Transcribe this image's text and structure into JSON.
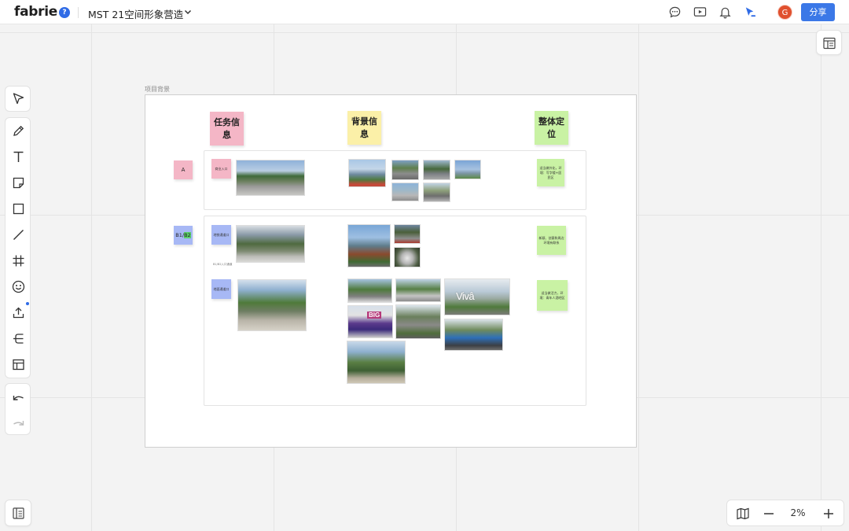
{
  "app": {
    "logo": "fabrie",
    "help": "?",
    "title": "MST 21空间形象营造",
    "avatar_letter": "G",
    "share_label": "分享"
  },
  "colors": {
    "accent": "#3b78e7",
    "pink": "#f4b6c6",
    "yellow": "#fbf0a8",
    "green": "#c9f2a4",
    "blue": "#a7b8f5"
  },
  "icons": {
    "top": [
      "comment-icon",
      "present-icon",
      "bell-icon",
      "cursor-share-icon"
    ],
    "tools": [
      "select-icon",
      "pen-icon",
      "text-icon",
      "sticky-note-icon",
      "rectangle-icon",
      "line-icon",
      "frame-icon",
      "emoji-icon",
      "upload-icon",
      "mindmap-icon",
      "table-icon",
      "undo-icon",
      "redo-icon"
    ]
  },
  "board": {
    "frame_label": "项目背景",
    "headers": {
      "task": "任务信息",
      "background": "背景信息",
      "positioning": "整体定位"
    },
    "rows": {
      "a_label": "A",
      "b_label_prefix": "B1/",
      "b_label_highlight": "B2"
    },
    "notes": {
      "a_task": "商业入口",
      "a_position": "适当做外化，环境：写字楼+居民区",
      "b1_task": "地铁通道口",
      "b1_caption": "B1/B2入口通道",
      "b1_position": "新颖、创意和周边环境有联系",
      "b2_task": "地面通道口",
      "b2_position": "适当做活力，环境：青年人酒吧区"
    },
    "photo_text": {
      "big": "BIG",
      "vive": "Vivâ"
    }
  },
  "zoom": {
    "level": "2%"
  }
}
